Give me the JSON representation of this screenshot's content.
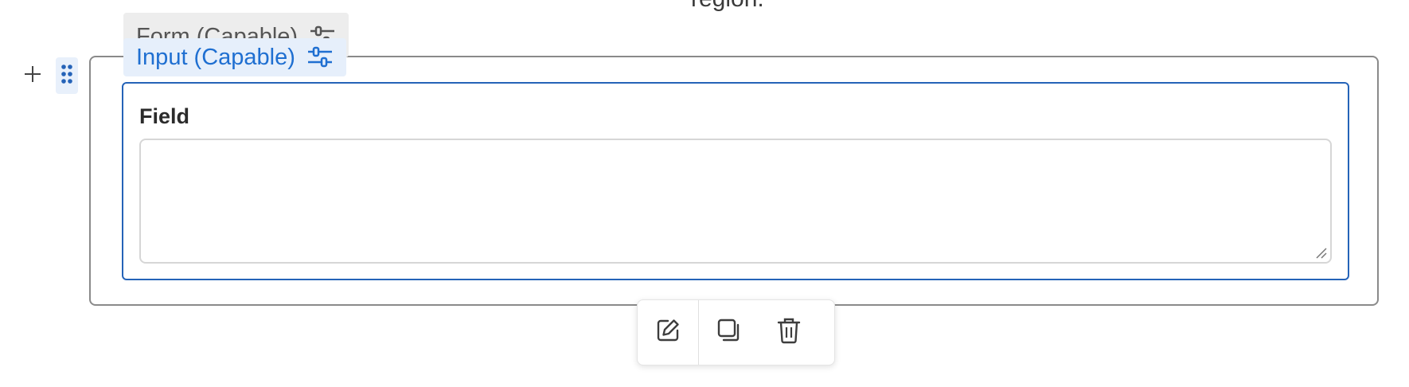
{
  "canvas": {
    "top_text": "region."
  },
  "form_block": {
    "tag_label": "Form (Capable)",
    "settings_icon": "sliders-icon"
  },
  "input_block": {
    "tag_label": "Input (Capable)",
    "settings_icon": "sliders-icon",
    "field_label": "Field",
    "field_value": ""
  },
  "block_controls": {
    "add_icon": "plus-icon",
    "drag_icon": "drag-dots-icon"
  },
  "toolbar": {
    "edit_icon": "edit-icon",
    "duplicate_icon": "duplicate-icon",
    "delete_icon": "trash-icon"
  },
  "colors": {
    "accent": "#2563b8",
    "tag_active_bg": "#e6effb",
    "tag_inactive_bg": "#ededed",
    "container_border": "#8a8a8a"
  }
}
